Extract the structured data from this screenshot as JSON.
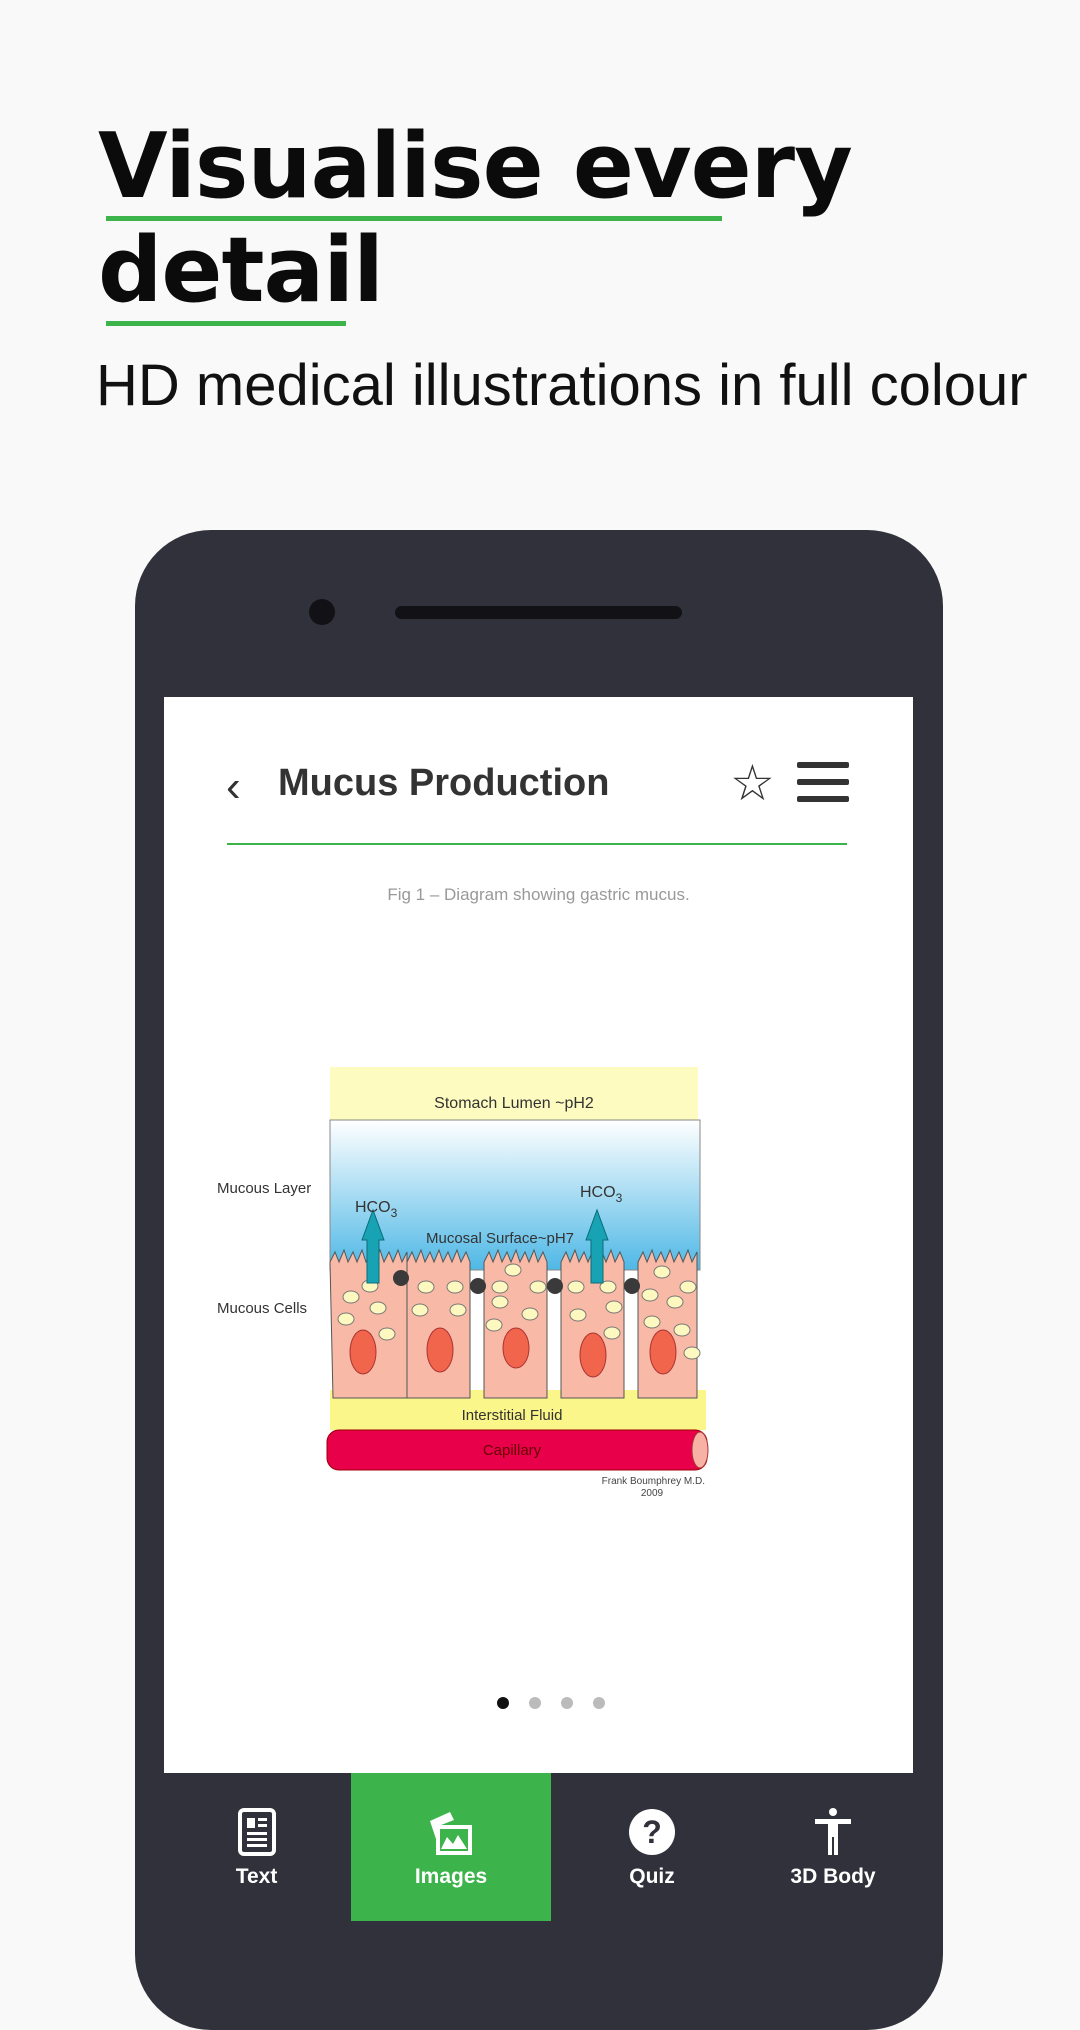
{
  "hero": {
    "title_line1": "Visualise every",
    "title_line2": "detail",
    "subtitle": "HD medical illustrations in full colour",
    "accent": "#3cb44b"
  },
  "screen": {
    "header": {
      "title": "Mucus Production",
      "back_icon": "chevron-left-icon",
      "favorite_icon": "star-outline-icon",
      "menu_icon": "hamburger-menu-icon"
    },
    "caption": "Fig 1 – Diagram showing gastric mucus.",
    "diagram": {
      "lumen": "Stomach Lumen ~pH2",
      "mucous_layer": "Mucous Layer",
      "mucous_cells": "Mucous Cells",
      "hco3": "HCO",
      "hco3_sub": "3",
      "surface": "Mucosal Surface~pH7",
      "interstitial": "Interstitial Fluid",
      "capillary": "Capillary",
      "credit_line1": "Frank Boumphrey M.D.",
      "credit_line2": "2009"
    },
    "pager": {
      "count": 4,
      "active": 1
    }
  },
  "nav": {
    "items": [
      {
        "label": "Text",
        "icon": "article-icon",
        "active": false
      },
      {
        "label": "Images",
        "icon": "images-icon",
        "active": true
      },
      {
        "label": "Quiz",
        "icon": "question-circle-icon",
        "active": false
      },
      {
        "label": "3D Body",
        "icon": "human-figure-icon",
        "active": false
      }
    ]
  }
}
